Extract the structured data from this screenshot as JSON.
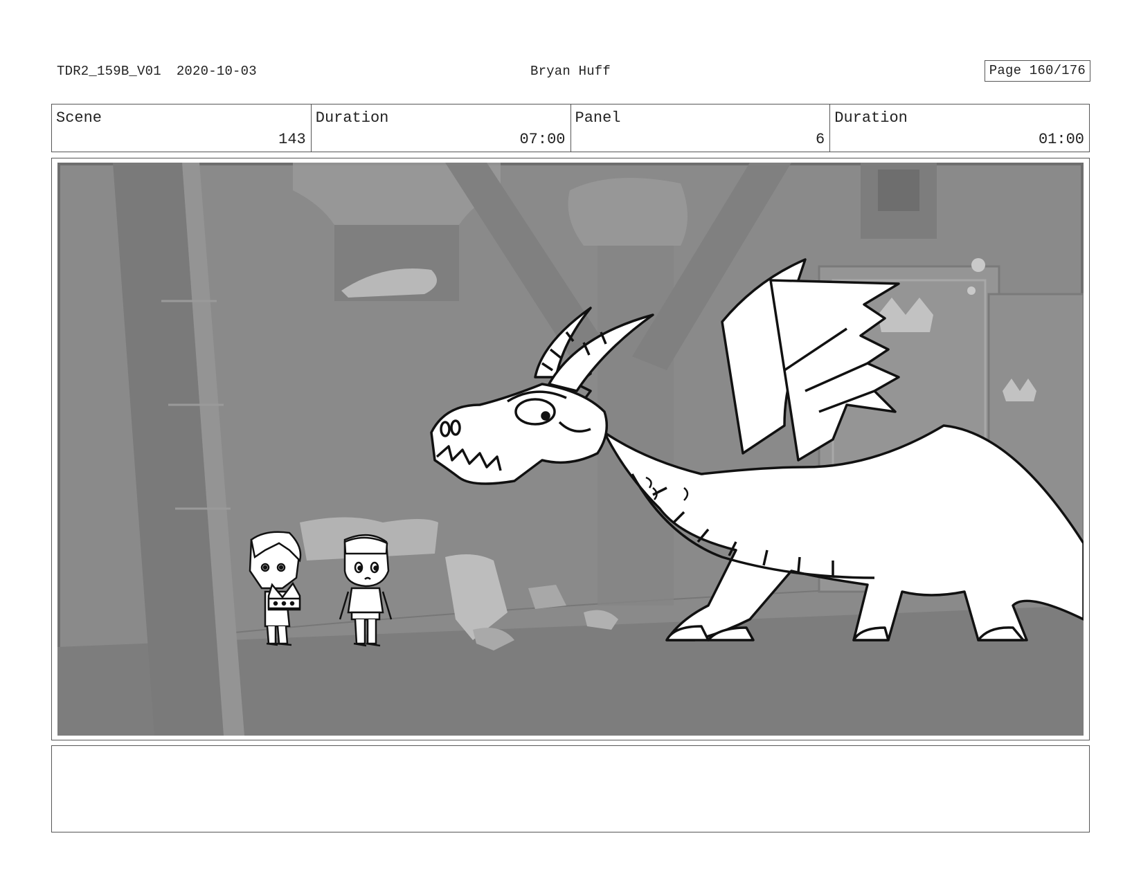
{
  "header": {
    "file_id": "TDR2_159B_V01",
    "date": "2020-10-03",
    "artist": "Bryan Huff",
    "page": "Page 160/176"
  },
  "info": {
    "scene_label": "Scene",
    "scene_value": "143",
    "scene_duration_label": "Duration",
    "scene_duration_value": "07:00",
    "panel_label": "Panel",
    "panel_value": "6",
    "panel_duration_label": "Duration",
    "panel_duration_value": "01:00"
  },
  "notes": {
    "text": ""
  },
  "colors": {
    "background_gray": "#8a8a8a",
    "line_art": "#111111",
    "character_fill": "#ffffff"
  }
}
